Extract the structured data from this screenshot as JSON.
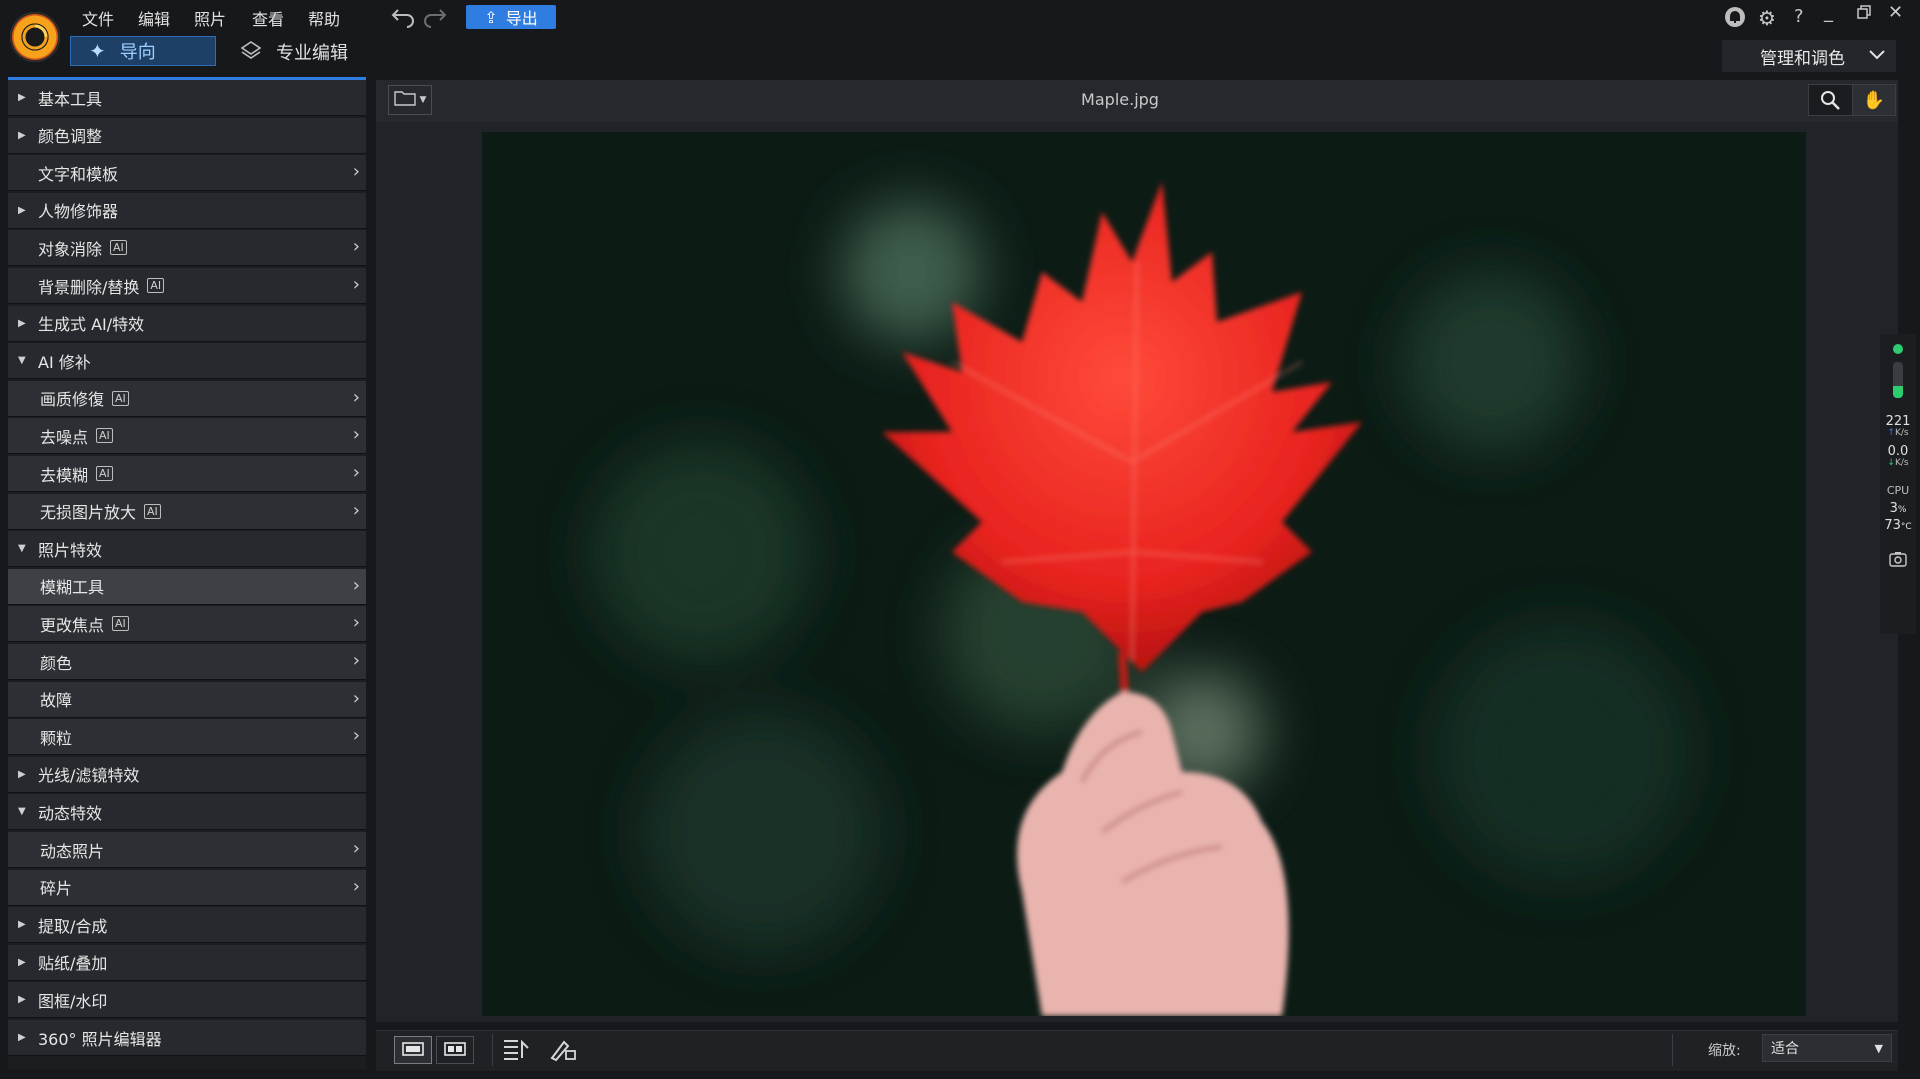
{
  "app": {
    "logo": "app-logo-icon"
  },
  "menu": [
    "文件",
    "编辑",
    "照片",
    "查看",
    "帮助"
  ],
  "toolbar": {
    "export_label": "导出",
    "undo": "undo-icon",
    "redo": "redo-icon"
  },
  "modes": {
    "guide_label": "导向",
    "expert_label": "专业编辑",
    "manage_label": "管理和调色"
  },
  "window": {
    "icons": [
      "notification-icon",
      "settings-icon",
      "help-icon",
      "minimize-icon",
      "restore-icon",
      "close-icon"
    ],
    "help_glyph": "?"
  },
  "panel": {
    "rows": [
      {
        "label": "基本工具",
        "type": "group",
        "state": "collapsed"
      },
      {
        "label": "颜色调整",
        "type": "group",
        "state": "collapsed"
      },
      {
        "label": "文字和模板",
        "type": "item"
      },
      {
        "label": "人物修饰器",
        "type": "group",
        "state": "collapsed"
      },
      {
        "label": "对象消除",
        "type": "item",
        "ai": true
      },
      {
        "label": "背景删除/替换",
        "type": "item",
        "ai": true
      },
      {
        "label": "生成式 AI/特效",
        "type": "group",
        "state": "collapsed"
      },
      {
        "label": "AI 修补",
        "type": "group",
        "state": "expanded"
      },
      {
        "label": "画质修復",
        "type": "sub",
        "ai": true
      },
      {
        "label": "去噪点",
        "type": "sub",
        "ai": true
      },
      {
        "label": "去模糊",
        "type": "sub",
        "ai": true
      },
      {
        "label": "无损图片放大",
        "type": "sub",
        "ai": true
      },
      {
        "label": "照片特效",
        "type": "group",
        "state": "expanded"
      },
      {
        "label": "模糊工具",
        "type": "sub",
        "selected": true
      },
      {
        "label": "更改焦点",
        "type": "sub",
        "ai": true
      },
      {
        "label": "颜色",
        "type": "sub"
      },
      {
        "label": "故障",
        "type": "sub"
      },
      {
        "label": "颗粒",
        "type": "sub"
      },
      {
        "label": "光线/滤镜特效",
        "type": "group",
        "state": "collapsed"
      },
      {
        "label": "动态特效",
        "type": "group",
        "state": "expanded"
      },
      {
        "label": "动态照片",
        "type": "sub"
      },
      {
        "label": "碎片",
        "type": "sub"
      },
      {
        "label": "提取/合成",
        "type": "group",
        "state": "collapsed"
      },
      {
        "label": "贴纸/叠加",
        "type": "group",
        "state": "collapsed"
      },
      {
        "label": "图框/水印",
        "type": "group",
        "state": "collapsed"
      },
      {
        "label": "360° 照片编辑器",
        "type": "group",
        "state": "collapsed"
      }
    ],
    "ai_badge": "AI"
  },
  "viewer": {
    "filename": "Maple.jpg",
    "tools": [
      "zoom-icon",
      "hand-pan-icon"
    ]
  },
  "stats": {
    "upload": "221",
    "upload_unit": "K/s",
    "download": "0.0",
    "download_unit": "K/s",
    "cpu_label": "CPU",
    "cpu": "3",
    "cpu_unit": "%",
    "temp": "73",
    "temp_unit": "°C"
  },
  "bottom": {
    "zoom_label": "缩放:",
    "zoom_value": "适合"
  },
  "colors": {
    "accent": "#2f7de0",
    "leaf": "#e8231f",
    "status_green": "#2ecc71"
  }
}
